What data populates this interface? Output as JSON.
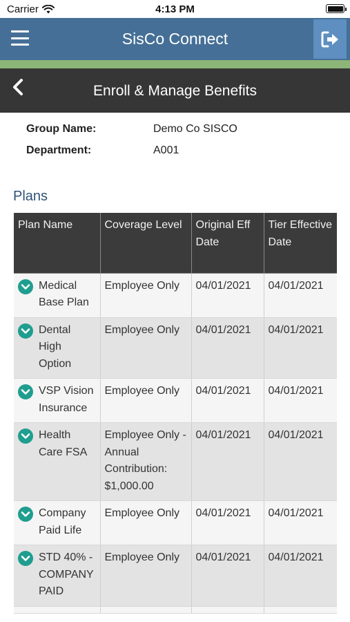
{
  "status": {
    "carrier": "Carrier",
    "time": "4:13 PM"
  },
  "appbar": {
    "title": "SisCo Connect"
  },
  "page": {
    "title": "Enroll & Manage Benefits"
  },
  "group": {
    "group_name_label": "Group Name:",
    "group_name": "Demo Co SISCO",
    "department_label": "Department:",
    "department": "A001"
  },
  "plans": {
    "heading": "Plans",
    "columns": [
      "Plan Name",
      "Coverage Level",
      "Original Eff Date",
      "Tier Effective Date"
    ],
    "rows": [
      {
        "plan": "Medical Base Plan",
        "coverage": "Employee Only",
        "original": "04/01/2021",
        "tier": "04/01/2021"
      },
      {
        "plan": "Dental High Option",
        "coverage": "Employee Only",
        "original": "04/01/2021",
        "tier": "04/01/2021"
      },
      {
        "plan": "VSP Vision Insurance",
        "coverage": "Employee Only",
        "original": "04/01/2021",
        "tier": "04/01/2021"
      },
      {
        "plan": "Health Care FSA",
        "coverage": "Employee Only - Annual Contribution: $1,000.00",
        "original": "04/01/2021",
        "tier": "04/01/2021"
      },
      {
        "plan": "Company Paid Life",
        "coverage": "Employee Only",
        "original": "04/01/2021",
        "tier": "04/01/2021"
      },
      {
        "plan": "STD 40% - COMPANY PAID",
        "coverage": "Employee Only",
        "original": "04/01/2021",
        "tier": "04/01/2021"
      }
    ]
  },
  "colors": {
    "appbar": "#456f96",
    "accent_green": "#8cb578",
    "subheader": "#363636",
    "expand_icon": "#1f9e8f"
  },
  "icons": {
    "menu": "hamburger-icon",
    "logout": "logout-icon",
    "back": "chevron-left-icon",
    "expand": "chevron-down-circle-icon"
  }
}
